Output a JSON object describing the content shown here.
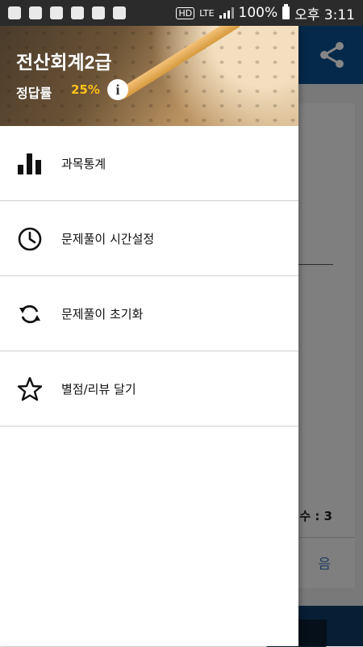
{
  "status_bar": {
    "battery": "100%",
    "time": "오후 3:11",
    "hd_label": "HD",
    "network": "LTE"
  },
  "drawer": {
    "title": "전산회계2급",
    "rate_label": "정답률",
    "rate_value": "25%",
    "items": [
      {
        "label": "과목통계",
        "icon": "bar-chart-icon"
      },
      {
        "label": "문제풀이 시간설정",
        "icon": "clock-icon"
      },
      {
        "label": "문제풀이 초기화",
        "icon": "refresh-icon"
      },
      {
        "label": "별점/리뷰 달기",
        "icon": "star-icon"
      }
    ]
  },
  "background": {
    "count_text": "수 : 3",
    "next_text": "음"
  },
  "colors": {
    "toolbar": "#0a4f8e",
    "rate_accent": "#ffc21a",
    "link": "#3d71b7"
  }
}
